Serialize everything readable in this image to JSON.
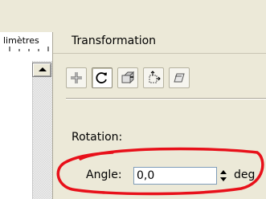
{
  "ruler": {
    "unit_label": "limètres"
  },
  "docker": {
    "title": "Transformation",
    "toolbar": [
      {
        "name": "position",
        "icon": "position-move-icon",
        "active": false
      },
      {
        "name": "rotation",
        "icon": "rotate-icon",
        "active": true
      },
      {
        "name": "scale-mirror",
        "icon": "scale-mirror-icon",
        "active": false
      },
      {
        "name": "size",
        "icon": "size-icon",
        "active": false
      },
      {
        "name": "skew",
        "icon": "skew-icon",
        "active": false
      }
    ],
    "section_label": "Rotation:",
    "angle": {
      "label": "Angle:",
      "value": "0,0",
      "unit": "deg"
    }
  },
  "annotation": {
    "highlight_color": "#e8101a"
  }
}
